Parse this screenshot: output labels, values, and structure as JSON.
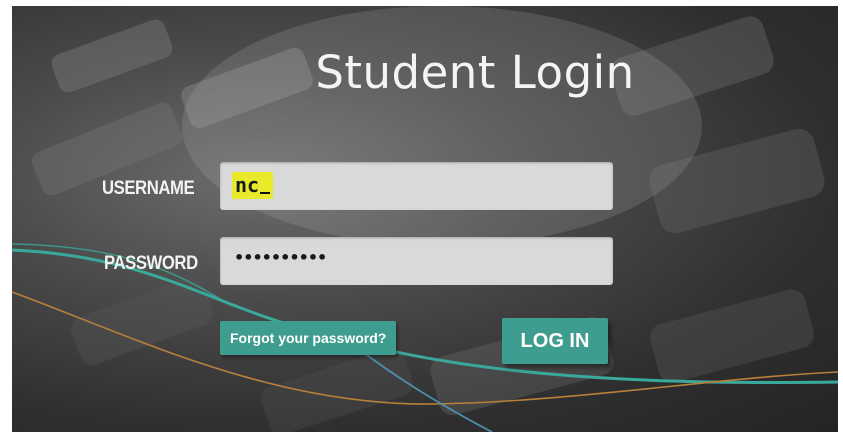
{
  "page": {
    "title": "Student Login"
  },
  "form": {
    "username": {
      "label": "USERNAME",
      "value": "nc"
    },
    "password": {
      "label": "PASSWORD",
      "masked_value": "••••••••••"
    },
    "forgot_label": "Forgot your password?",
    "login_label": "LOG IN"
  },
  "colors": {
    "button": "#3f9d8f",
    "highlight": "#e8ea2a",
    "field": "#d9d9d9",
    "curve_teal": "#3aa89a",
    "curve_orange": "#b9803a",
    "curve_blue": "#4e8fb0"
  }
}
